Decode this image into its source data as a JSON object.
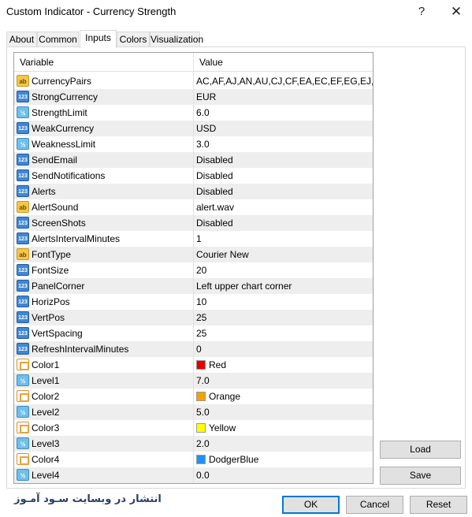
{
  "window": {
    "title": "Custom Indicator - Currency Strength",
    "help_glyph": "?",
    "close_glyph": "✕"
  },
  "tabs": [
    {
      "label": "About"
    },
    {
      "label": "Common"
    },
    {
      "label": "Inputs",
      "active": true
    },
    {
      "label": "Colors"
    },
    {
      "label": "Visualization"
    }
  ],
  "grid": {
    "headers": {
      "variable": "Variable",
      "value": "Value"
    },
    "rows": [
      {
        "type": "ab",
        "variable": "CurrencyPairs",
        "value": "AC,AF,AJ,AN,AU,CJ,CF,EA,EC,EF,EG,EJ,E..."
      },
      {
        "type": "123",
        "variable": "StrongCurrency",
        "value": "EUR"
      },
      {
        "type": "half",
        "variable": "StrengthLimit",
        "value": "6.0"
      },
      {
        "type": "123",
        "variable": "WeakCurrency",
        "value": "USD"
      },
      {
        "type": "half",
        "variable": "WeaknessLimit",
        "value": "3.0"
      },
      {
        "type": "123",
        "variable": "SendEmail",
        "value": "Disabled"
      },
      {
        "type": "123",
        "variable": "SendNotifications",
        "value": "Disabled"
      },
      {
        "type": "123",
        "variable": "Alerts",
        "value": "Disabled"
      },
      {
        "type": "ab",
        "variable": "AlertSound",
        "value": "alert.wav"
      },
      {
        "type": "123",
        "variable": "ScreenShots",
        "value": "Disabled"
      },
      {
        "type": "123",
        "variable": "AlertsIntervalMinutes",
        "value": "1"
      },
      {
        "type": "ab",
        "variable": "FontType",
        "value": "Courier New"
      },
      {
        "type": "123",
        "variable": "FontSize",
        "value": "20"
      },
      {
        "type": "123",
        "variable": "PanelCorner",
        "value": "Left upper chart corner"
      },
      {
        "type": "123",
        "variable": "HorizPos",
        "value": "10"
      },
      {
        "type": "123",
        "variable": "VertPos",
        "value": "25"
      },
      {
        "type": "123",
        "variable": "VertSpacing",
        "value": "25"
      },
      {
        "type": "123",
        "variable": "RefreshIntervalMinutes",
        "value": "0"
      },
      {
        "type": "color",
        "variable": "Color1",
        "value": "Red",
        "color": "#e60000"
      },
      {
        "type": "half",
        "variable": "Level1",
        "value": "7.0"
      },
      {
        "type": "color",
        "variable": "Color2",
        "value": "Orange",
        "color": "#f5a000"
      },
      {
        "type": "half",
        "variable": "Level2",
        "value": "5.0"
      },
      {
        "type": "color",
        "variable": "Color3",
        "value": "Yellow",
        "color": "#ffff00"
      },
      {
        "type": "half",
        "variable": "Level3",
        "value": "2.0"
      },
      {
        "type": "color",
        "variable": "Color4",
        "value": "DodgerBlue",
        "color": "#1e90ff"
      },
      {
        "type": "half",
        "variable": "Level4",
        "value": "0.0"
      }
    ]
  },
  "icon_glyphs": {
    "ab": "ab",
    "123": "123",
    "half": "½"
  },
  "buttons": {
    "load": "Load",
    "save": "Save",
    "ok": "OK",
    "cancel": "Cancel",
    "reset": "Reset"
  },
  "watermark": "انتشار در وبسایت سـود آمـوز"
}
